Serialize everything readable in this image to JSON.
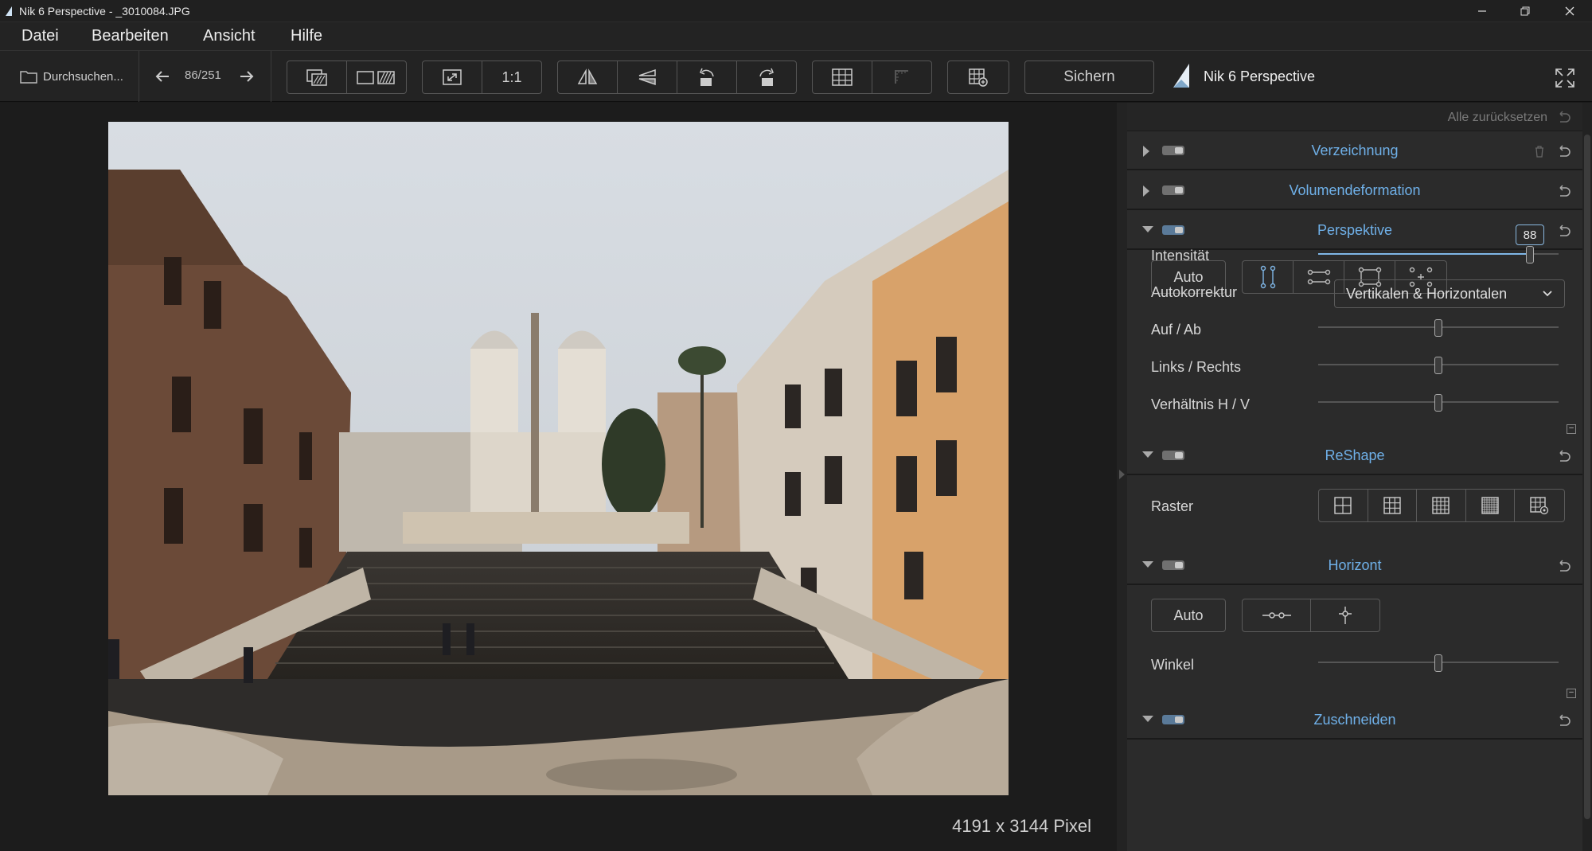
{
  "window": {
    "title": "Nik 6 Perspective - _3010084.JPG"
  },
  "menu": [
    "Datei",
    "Bearbeiten",
    "Ansicht",
    "Hilfe"
  ],
  "toolbar": {
    "browse_label": "Durchsuchen...",
    "counter": "86/251",
    "zoom_1_1": "1:1",
    "save_label": "Sichern",
    "brand": "Nik 6 Perspective"
  },
  "canvas": {
    "dimensions": "4191 x 3144 Pixel"
  },
  "panel": {
    "reset_all": "Alle zurücksetzen",
    "sections": {
      "verzeichnung": "Verzeichnung",
      "volumendeformation": "Volumendeformation",
      "perspektive": "Perspektive",
      "reshape": "ReShape",
      "horizont": "Horizont",
      "zuschneiden": "Zuschneiden"
    },
    "perspektive": {
      "auto_label": "Auto",
      "intensity_label": "Intensität",
      "intensity_value": "88",
      "intensity": 88,
      "autokorrektur_label": "Autokorrektur",
      "autokorrektur_value": "Vertikalen & Horizontalen",
      "auf_ab_label": "Auf / Ab",
      "links_rechts_label": "Links / Rechts",
      "verhaeltnis_label": "Verhältnis H / V",
      "auf_ab": 0,
      "links_rechts": 0,
      "verhaeltnis": 0
    },
    "reshape": {
      "raster_label": "Raster"
    },
    "horizont": {
      "auto_label": "Auto",
      "winkel_label": "Winkel",
      "winkel": 0
    }
  },
  "colors": {
    "accent": "#6fb0e8",
    "panel_bg": "#2b2b2b",
    "toolbar_bg": "#232323"
  }
}
